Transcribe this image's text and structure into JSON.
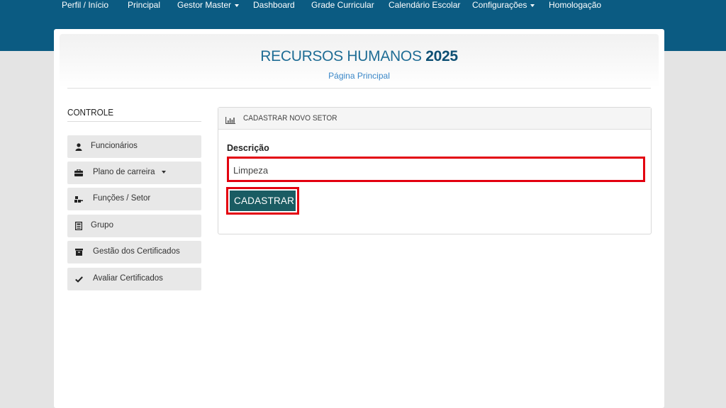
{
  "nav": {
    "items": [
      {
        "label": "Perfil / Início"
      },
      {
        "label": "Principal"
      },
      {
        "label": "Gestor Master"
      },
      {
        "label": "Dashboard"
      },
      {
        "label": "Grade Curricular"
      },
      {
        "label": "Calendário Escolar"
      },
      {
        "label": "Configurações"
      },
      {
        "label": "Homologação"
      }
    ]
  },
  "header": {
    "title_main": "RECURSOS HUMANOS",
    "title_year": "2025",
    "subtitle": "Página Principal"
  },
  "sidebar": {
    "title": "CONTROLE",
    "items": [
      {
        "label": "Funcionários",
        "icon": "user-icon"
      },
      {
        "label": "Plano de carreira",
        "icon": "briefcase-icon"
      },
      {
        "label": "Funções / Setor",
        "icon": "sitemap-icon"
      },
      {
        "label": "Grupo",
        "icon": "building-icon"
      },
      {
        "label": "Gestão dos Certificados",
        "icon": "archive-icon"
      },
      {
        "label": "Avaliar Certificados",
        "icon": "check-icon"
      }
    ]
  },
  "form": {
    "title": "CADASTRAR NOVO SETOR",
    "field_label": "Descrição",
    "field_value": "Limpeza",
    "submit_label": "CADASTRAR"
  },
  "colors": {
    "topbar": "#0b5b82",
    "button": "#1a5c63",
    "highlight": "#e3000f",
    "title": "#1f6d95"
  }
}
